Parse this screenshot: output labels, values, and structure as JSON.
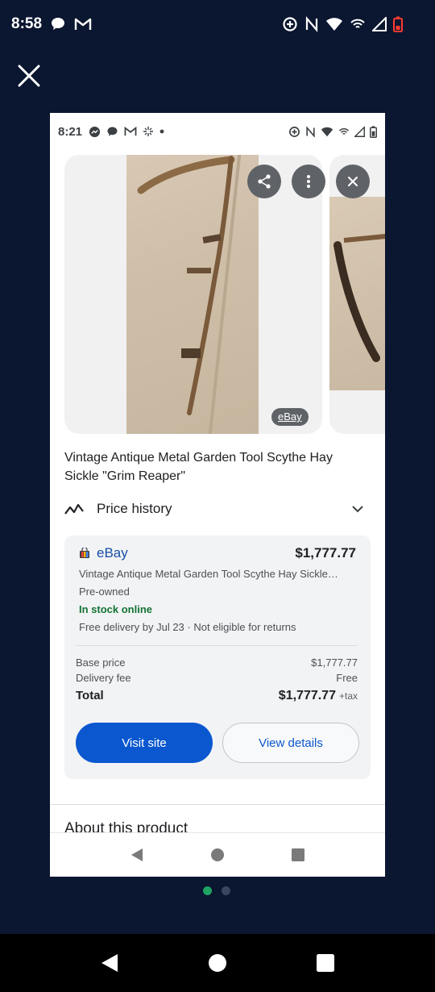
{
  "outer_status": {
    "time": "8:58"
  },
  "inner_status": {
    "time": "8:21"
  },
  "gallery": {
    "source_tag": "eBay"
  },
  "product": {
    "title": "Vintage Antique Metal Garden Tool Scythe Hay Sickle \"Grim Reaper\""
  },
  "price_history": {
    "label": "Price history"
  },
  "offer": {
    "merchant": "eBay",
    "price": "$1,777.77",
    "description": "Vintage Antique Metal Garden Tool Scythe Hay Sickle…",
    "condition": "Pre-owned",
    "stock": "In stock online",
    "delivery": "Free delivery by Jul 23 · Not eligible for returns",
    "base_price_label": "Base price",
    "base_price_value": "$1,777.77",
    "delivery_fee_label": "Delivery fee",
    "delivery_fee_value": "Free",
    "total_label": "Total",
    "total_value": "$1,777.77",
    "tax_label": "+tax",
    "visit_label": "Visit site",
    "details_label": "View details"
  },
  "about": {
    "label": "About this product"
  },
  "colors": {
    "accent": "#0b57d0",
    "stock_green": "#137333",
    "background": "#0b1630",
    "page_indicator_active": "#1ea362"
  }
}
